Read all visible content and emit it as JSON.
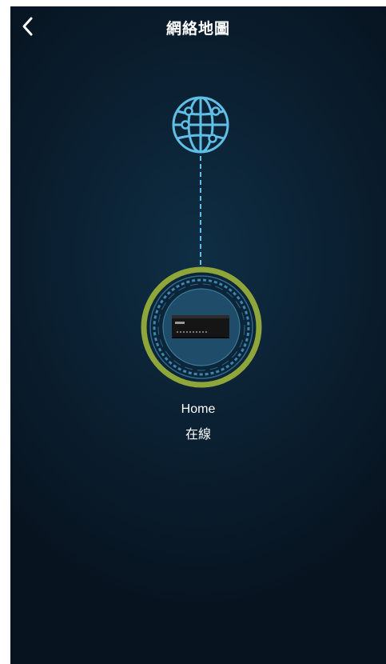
{
  "header": {
    "title": "網絡地圖",
    "back_icon": "chevron-left-icon"
  },
  "map": {
    "internet_icon": "globe-icon",
    "device": {
      "name": "Home",
      "status": "在線",
      "icon": "router-icon",
      "status_ring_color": "#8ea63a"
    },
    "link_color": "#5fbfe6"
  }
}
